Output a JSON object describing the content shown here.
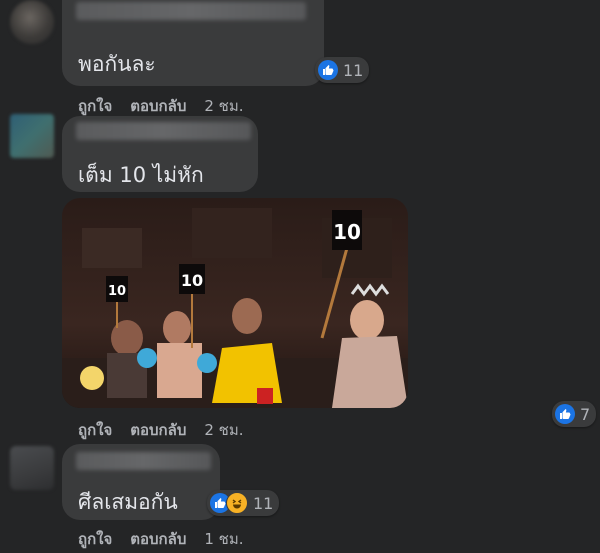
{
  "comments": [
    {
      "text": "พอกันละ",
      "reaction_count": "11",
      "actions": {
        "like": "ถูกใจ",
        "reply": "ตอบกลับ",
        "time": "2 ชม."
      }
    },
    {
      "text": "เต็ม 10 ไม่หัก",
      "reaction_count": "7",
      "photo_sign_labels": [
        "10",
        "10",
        "10"
      ],
      "actions": {
        "like": "ถูกใจ",
        "reply": "ตอบกลับ",
        "time": "2 ชม."
      }
    },
    {
      "text": "ศีลเสมอกัน",
      "reaction_count": "11",
      "actions": {
        "like": "ถูกใจ",
        "reply": "ตอบกลับ",
        "time": "1 ชม."
      }
    }
  ],
  "icons": [
    "like-icon",
    "haha-icon"
  ],
  "colors": {
    "background": "#242526",
    "bubble": "#3a3b3c",
    "like_blue": "#1b74e4",
    "haha_yellow": "#f7b125"
  }
}
